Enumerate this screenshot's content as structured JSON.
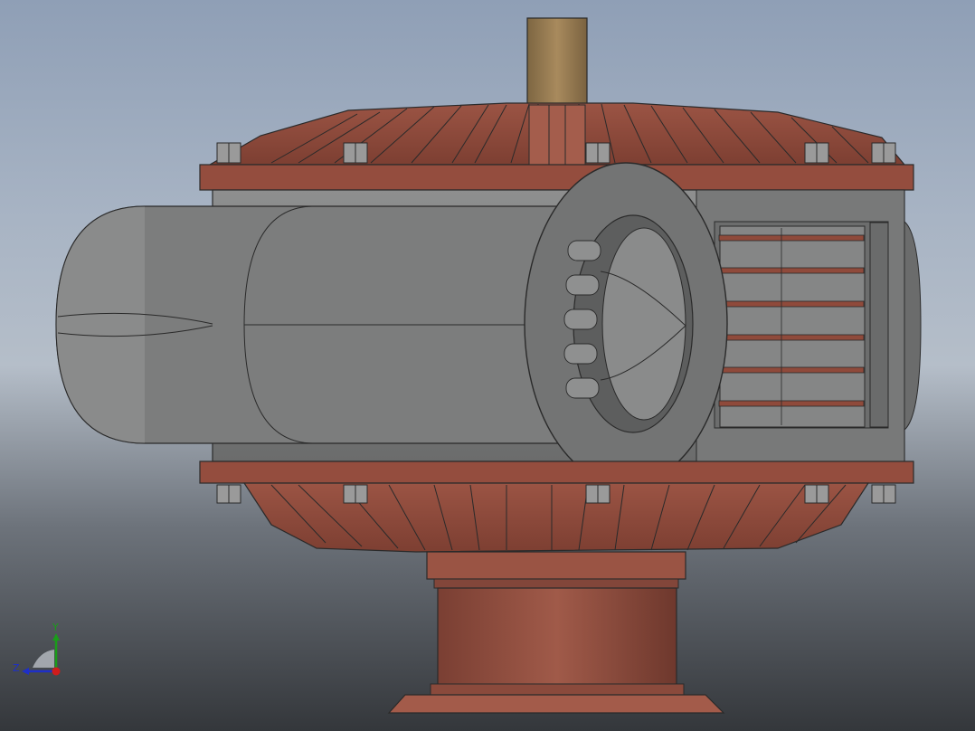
{
  "viewport": {
    "name": "cad-graphics-area",
    "colors": {
      "background_top": "#8f9fb6",
      "background_bottom": "#34373b",
      "copper": "#8e4a3b",
      "copper_light": "#a8604f",
      "steel": "#7e7f7f",
      "steel_dark": "#5e5f60",
      "brass_pipe": "#9b7f55"
    }
  },
  "triad": {
    "y_label": "Y",
    "z_label": "Z",
    "y_color": "#1a9c1a",
    "z_color": "#1e2fc8",
    "x_color": "#d01c1c"
  }
}
